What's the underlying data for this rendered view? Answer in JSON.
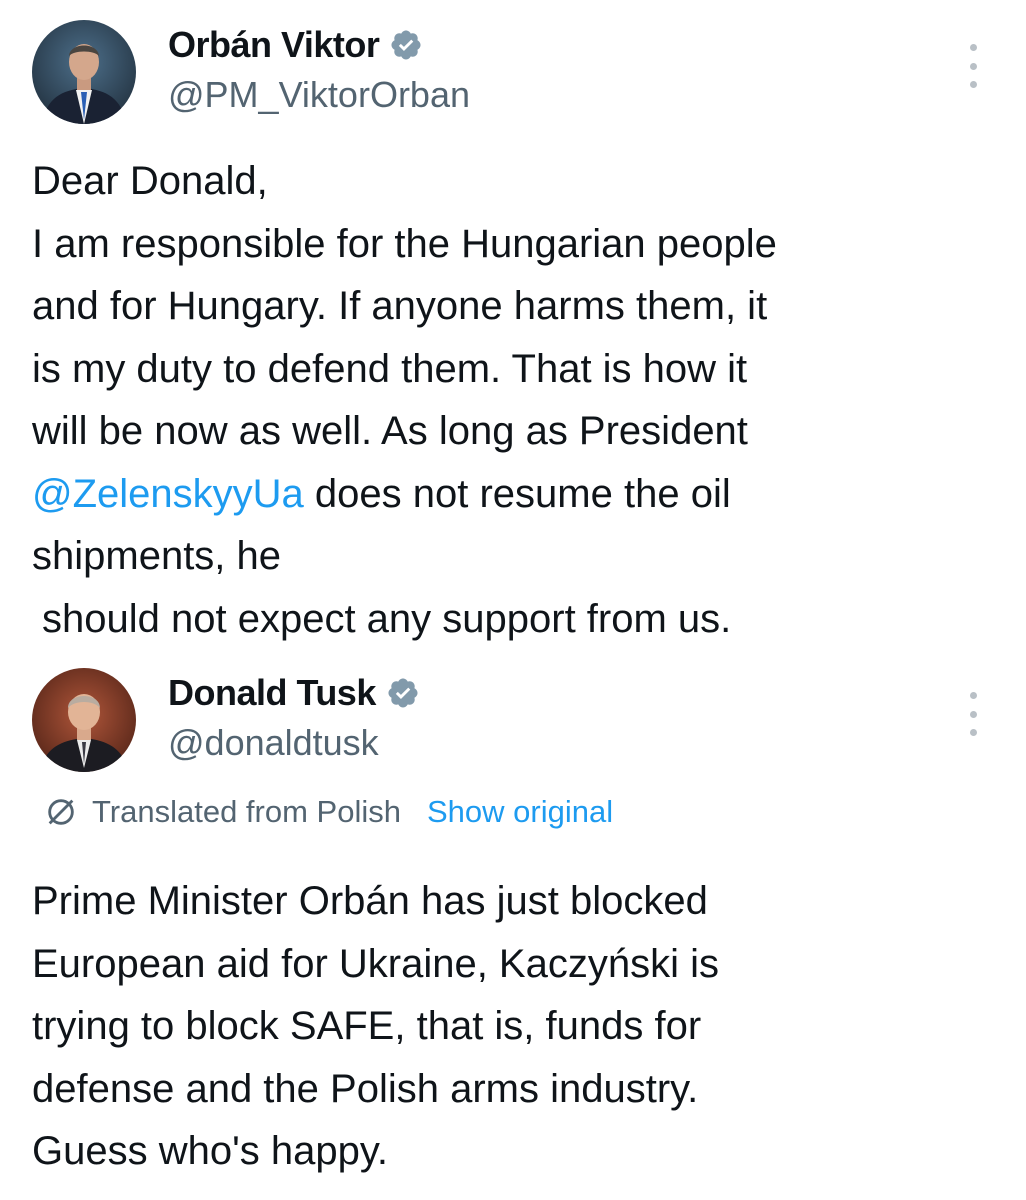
{
  "tweet1": {
    "display_name": "Orbán Viktor",
    "handle": "@PM_ViktorOrban",
    "avatar": "avatar-viktor-orban",
    "verified_icon": "verified-badge-icon",
    "more_icon": "more-options-icon",
    "text": {
      "line1": "Dear Donald,",
      "line2": "I am responsible for the Hungarian people",
      "line3": "and for Hungary. If anyone harms them, it",
      "line4": "is my duty to defend them. That is how it",
      "line5": "will be now as well. As long as President",
      "mention": "@ZelenskyyUa",
      "line6_rest": " does not resume the oil",
      "line7": "shipments, he",
      "line8": "should not expect any support from us."
    }
  },
  "tweet2": {
    "display_name": "Donald Tusk",
    "handle": "@donaldtusk",
    "avatar": "avatar-donald-tusk",
    "verified_icon": "verified-badge-icon",
    "more_icon": "more-options-icon",
    "translated_label": "Translated from Polish",
    "show_original_label": "Show original",
    "translate_icon": "translate-icon",
    "text": {
      "line1": "Prime Minister Orbán has just blocked",
      "line2": "European aid for Ukraine, Kaczyński is",
      "line3": "trying to block SAFE, that is, funds for",
      "line4": "defense and the Polish arms industry.",
      "line5": "Guess who's happy."
    }
  },
  "colors": {
    "text": "#0f1419",
    "secondary": "#536471",
    "link": "#1d9bf0",
    "verified_badge": "#829aab"
  }
}
